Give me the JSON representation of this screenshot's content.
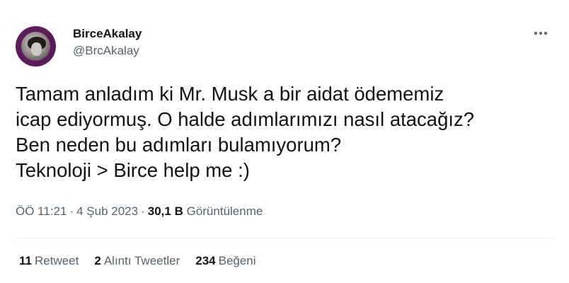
{
  "author": {
    "display_name": "BirceAkalay",
    "handle": "@BrcAkalay",
    "avatar_icon": "profile-photo"
  },
  "tweet": {
    "text": "Tamam anladım ki Mr. Musk a bir aidat ödememiz\nicap ediyormuş. O halde adımlarımızı nasıl atacağız?\nBen neden bu adımları bulamıyorum?\nTeknoloji > Birce help me :)"
  },
  "meta": {
    "time": "ÖÖ 11:21",
    "separator": "·",
    "date": "4 Şub 2023",
    "views_count": "30,1 B",
    "views_label": "Görüntülenme"
  },
  "stats": {
    "retweets_count": "11",
    "retweets_label": "Retweet",
    "quotes_count": "2",
    "quotes_label": "Alıntı Tweetler",
    "likes_count": "234",
    "likes_label": "Beğeni"
  },
  "colors": {
    "text_primary": "#0f1419",
    "text_secondary": "#536471",
    "divider": "#eff3f4",
    "avatar_ring": "#5e1b5c"
  }
}
